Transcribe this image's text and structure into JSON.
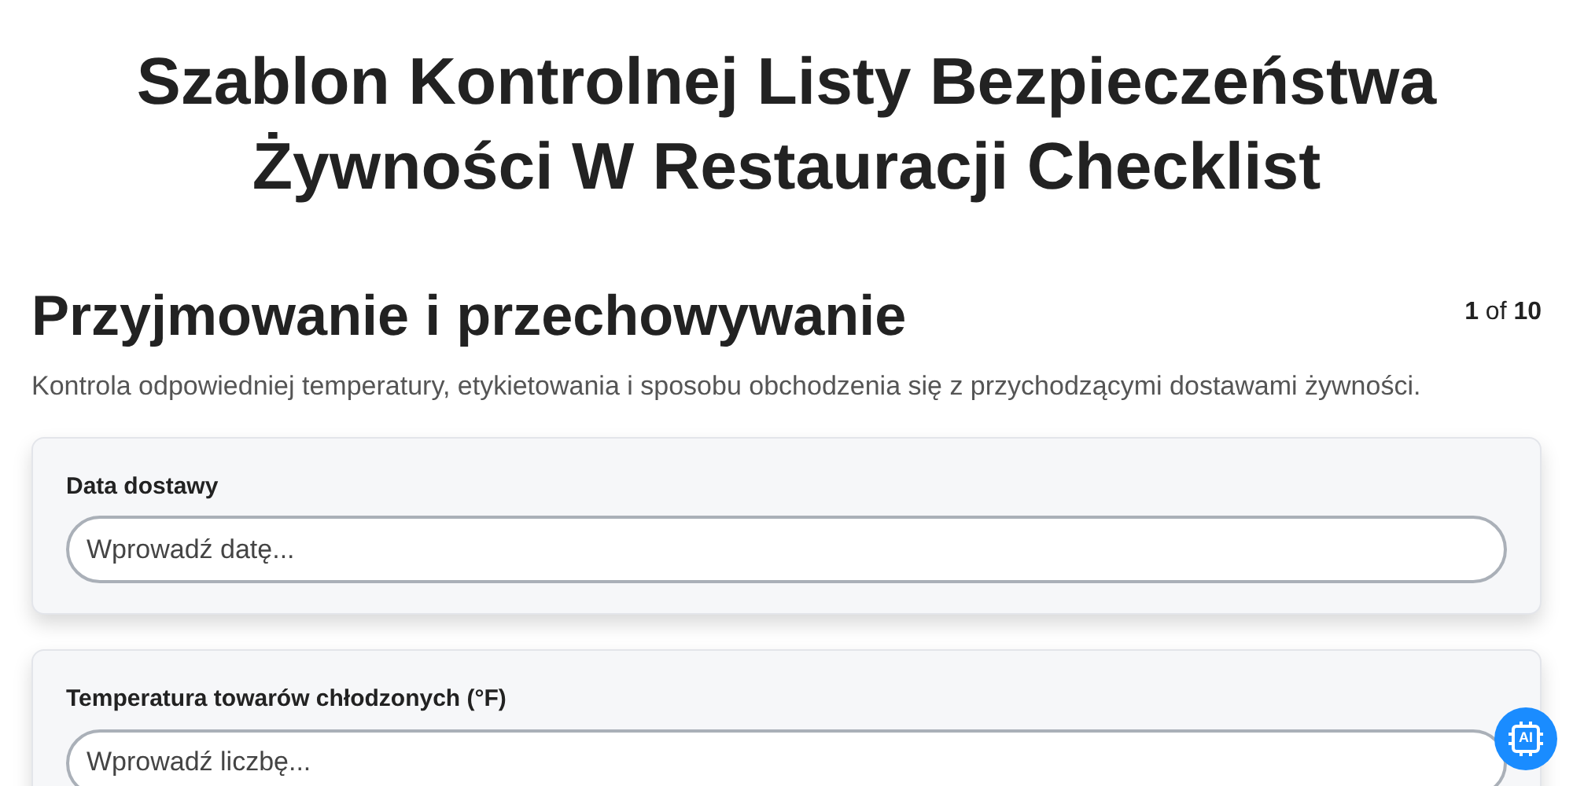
{
  "title": "Szablon Kontrolnej Listy Bezpieczeństwa Żywności W Restauracji Checklist",
  "section": {
    "heading": "Przyjmowanie i przechowywanie",
    "page_counter": "**1** of **10**",
    "description": "Kontrola odpowiedniej temperatury, etykietowania i sposobu obchodzenia się z przychodzącymi dostawami żywności."
  },
  "fields": [
    {
      "label": "Data dostawy",
      "placeholder": "Wprowadź datę..."
    },
    {
      "label": "Temperatura towarów chłodzonych (°F)",
      "placeholder": "Wprowadź liczbę..."
    }
  ],
  "ai_button": {
    "label": "AI"
  }
}
